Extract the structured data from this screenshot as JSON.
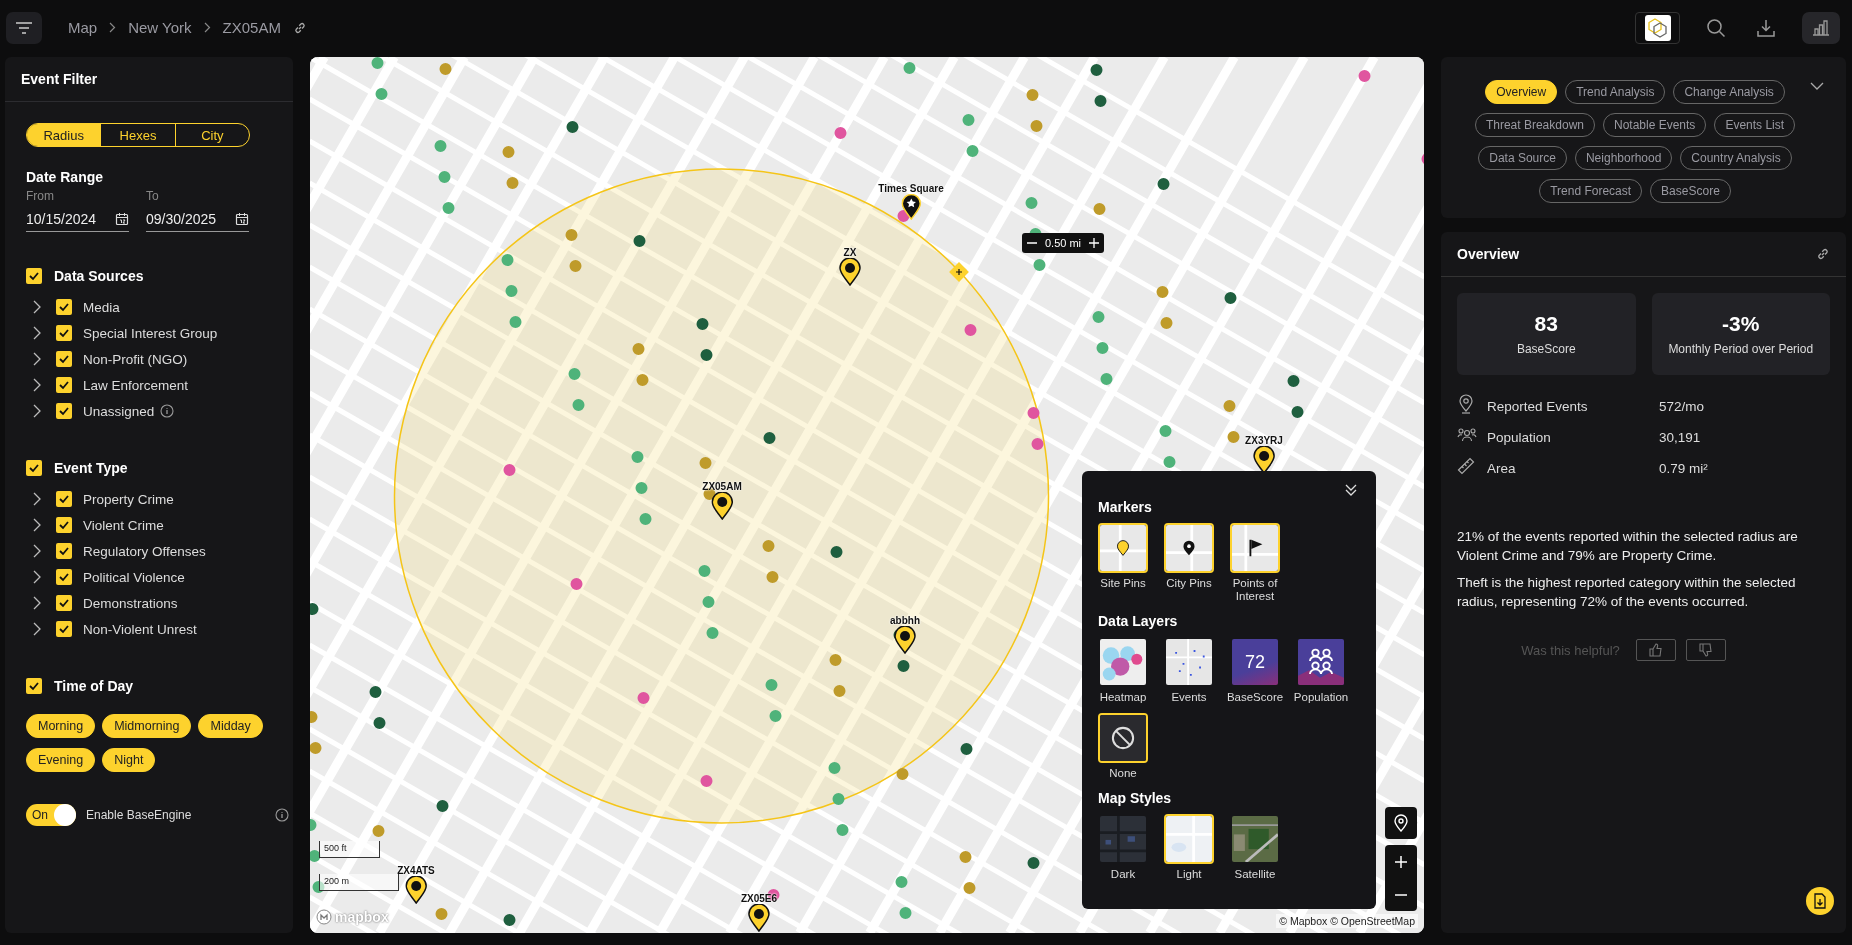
{
  "topbar": {
    "breadcrumb": [
      "Map",
      "New York",
      "ZX05AM"
    ]
  },
  "event_filter": {
    "title": "Event Filter",
    "modes": [
      {
        "label": "Radius",
        "selected": true
      },
      {
        "label": "Hexes",
        "selected": false
      },
      {
        "label": "City",
        "selected": false
      }
    ],
    "date_range": {
      "title": "Date Range",
      "from": {
        "label": "From",
        "value": "10/15/2024"
      },
      "to": {
        "label": "To",
        "value": "09/30/2025"
      }
    },
    "groups": [
      {
        "label": "Data Sources",
        "checked": true,
        "kind": "checklist",
        "items": [
          {
            "label": "Media",
            "checked": true,
            "info": false
          },
          {
            "label": "Special Interest Group",
            "checked": true,
            "info": false
          },
          {
            "label": "Non-Profit (NGO)",
            "checked": true,
            "info": false
          },
          {
            "label": "Law Enforcement",
            "checked": true,
            "info": false
          },
          {
            "label": "Unassigned",
            "checked": true,
            "info": true
          }
        ]
      },
      {
        "label": "Event Type",
        "checked": true,
        "kind": "checklist",
        "items": [
          {
            "label": "Property Crime",
            "checked": true,
            "info": false
          },
          {
            "label": "Violent Crime",
            "checked": true,
            "info": false
          },
          {
            "label": "Regulatory Offenses",
            "checked": true,
            "info": false
          },
          {
            "label": "Political Violence",
            "checked": true,
            "info": false
          },
          {
            "label": "Demonstrations",
            "checked": true,
            "info": false
          },
          {
            "label": "Non-Violent Unrest",
            "checked": true,
            "info": false
          }
        ]
      },
      {
        "label": "Time of Day",
        "checked": true,
        "kind": "chips",
        "items": [
          {
            "label": "Morning",
            "selected": true
          },
          {
            "label": "Midmorning",
            "selected": true
          },
          {
            "label": "Midday",
            "selected": true
          },
          {
            "label": "Evening",
            "selected": true
          },
          {
            "label": "Night",
            "selected": true
          }
        ]
      }
    ],
    "engine_toggle": {
      "on": true,
      "state_label": "On",
      "label": "Enable BaseEngine"
    }
  },
  "map": {
    "kind": "picture",
    "radius_control": {
      "value": "0.50 mi"
    },
    "markers": [
      {
        "kind": "poi",
        "label": "Times Square"
      },
      {
        "kind": "site",
        "label": "ZX"
      },
      {
        "kind": "site",
        "label": "ZX05AM"
      },
      {
        "kind": "site",
        "label": "ZX3YRJ"
      },
      {
        "kind": "site",
        "label": "abbhh"
      },
      {
        "kind": "site",
        "label": "ZX4ATS"
      },
      {
        "kind": "site",
        "label": "ZX05E6"
      }
    ],
    "scale": [
      "500 ft",
      "200 m"
    ],
    "logo": "mapbox",
    "attribution": "© Mapbox © OpenStreetMap",
    "layers_panel": {
      "sections": [
        {
          "title": "Markers",
          "options": [
            {
              "kind": "site-pins",
              "label": "Site Pins",
              "selected": true
            },
            {
              "kind": "city-pins",
              "label": "City Pins",
              "selected": true
            },
            {
              "kind": "poi",
              "label": "Points of Interest",
              "selected": true
            }
          ]
        },
        {
          "title": "Data Layers",
          "options": [
            {
              "kind": "heatmap",
              "label": "Heatmap",
              "selected": false
            },
            {
              "kind": "events",
              "label": "Events",
              "selected": false
            },
            {
              "kind": "basescore",
              "label": "BaseScore",
              "badge": "72",
              "selected": false
            },
            {
              "kind": "population",
              "label": "Population",
              "selected": false
            },
            {
              "kind": "none",
              "label": "None",
              "selected": true
            }
          ]
        },
        {
          "title": "Map Styles",
          "options": [
            {
              "kind": "dark",
              "label": "Dark",
              "selected": false
            },
            {
              "kind": "light",
              "label": "Light",
              "selected": true
            },
            {
              "kind": "satellite",
              "label": "Satellite",
              "selected": false
            }
          ]
        }
      ]
    }
  },
  "analysis_tabs": [
    {
      "label": "Overview",
      "selected": true
    },
    {
      "label": "Trend Analysis",
      "selected": false
    },
    {
      "label": "Change Analysis",
      "selected": false
    },
    {
      "label": "Threat Breakdown",
      "selected": false
    },
    {
      "label": "Notable Events",
      "selected": false
    },
    {
      "label": "Events List",
      "selected": false
    },
    {
      "label": "Data Source",
      "selected": false
    },
    {
      "label": "Neighborhood",
      "selected": false
    },
    {
      "label": "Country Analysis",
      "selected": false
    },
    {
      "label": "Trend Forecast",
      "selected": false
    },
    {
      "label": "BaseScore",
      "selected": false
    }
  ],
  "overview": {
    "title": "Overview",
    "stats": [
      {
        "value": "83",
        "label": "BaseScore"
      },
      {
        "value": "-3%",
        "label": "Monthly Period over Period"
      }
    ],
    "metrics": [
      {
        "kind": "pin",
        "label": "Reported Events",
        "value": "572/mo"
      },
      {
        "kind": "people",
        "label": "Population",
        "value": "30,191"
      },
      {
        "kind": "ruler",
        "label": "Area",
        "value": "0.79 mi²"
      }
    ],
    "paragraphs": [
      "21% of the events reported within the selected radius are Violent Crime and 79% are Property Crime.",
      "Theft is the highest reported category within the selected radius, representing 72% of the events occurred."
    ],
    "feedback": {
      "question": "Was this helpful?"
    }
  }
}
